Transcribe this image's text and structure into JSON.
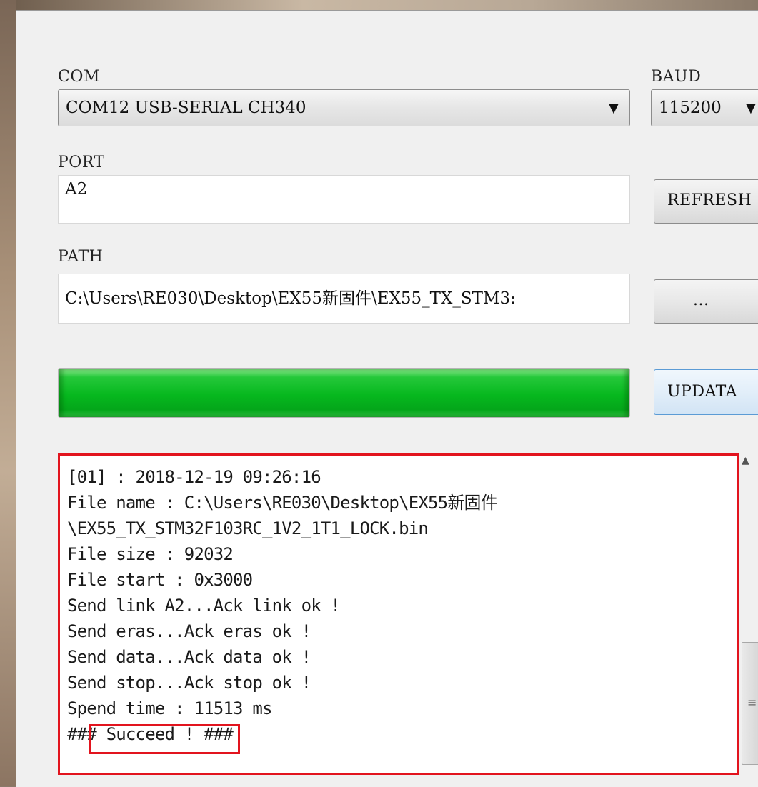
{
  "com": {
    "label": "COM",
    "selected": "COM12 USB-SERIAL CH340"
  },
  "baud": {
    "label": "BAUD",
    "selected": "115200"
  },
  "port": {
    "label": "PORT",
    "value": "A2"
  },
  "refresh_label": "REFRESH",
  "path": {
    "label": "PATH",
    "value": "C:\\Users\\RE030\\Desktop\\EX55新固件\\EX55_TX_STM3:"
  },
  "browse_label": "...",
  "update_label": "UPDATA",
  "progress": {
    "percent": 100,
    "color": "#06b81e"
  },
  "log": {
    "lines": [
      "[01] : 2018-12-19 09:26:16",
      "File name : C:\\Users\\RE030\\Desktop\\EX55新固件",
      "\\EX55_TX_STM32F103RC_1V2_1T1_LOCK.bin",
      "File size : 92032",
      "File start : 0x3000",
      "Send link A2...Ack link ok !",
      "Send eras...Ack eras ok !",
      "Send data...Ack data ok !",
      "Send stop...Ack stop ok !",
      "Spend time : 11513 ms",
      "### Succeed ! ###"
    ]
  },
  "icons": {
    "dropdown": "chevron-down-icon",
    "scroll_up": "scroll-up-icon"
  },
  "colors": {
    "highlight": "#e2141e",
    "progress_green": "#06b81e"
  }
}
